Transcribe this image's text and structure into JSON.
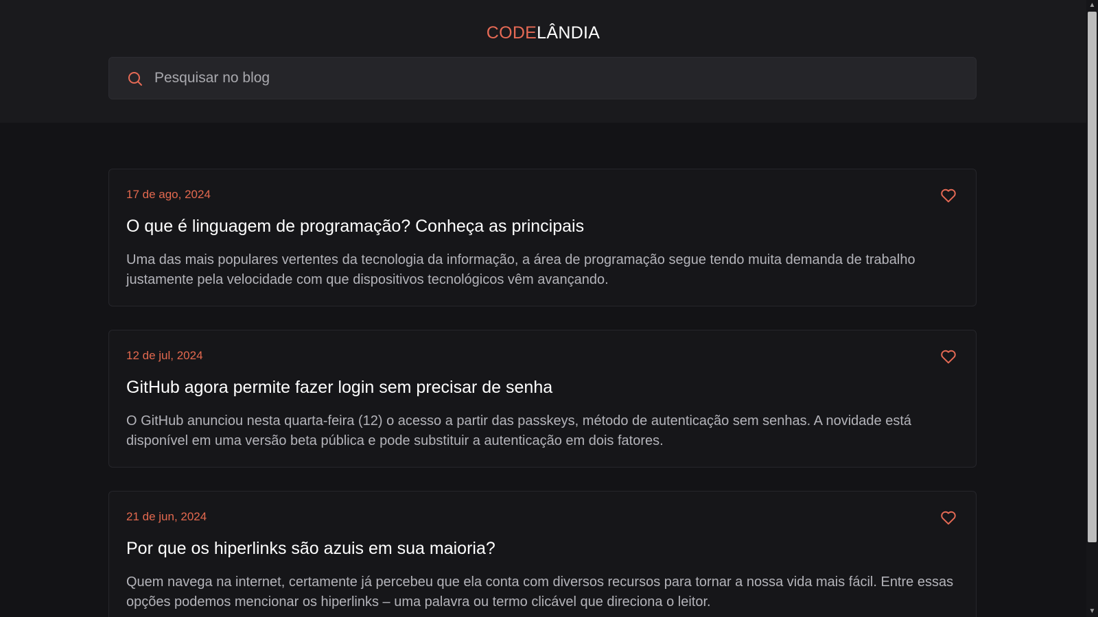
{
  "header": {
    "logo_accent": "CODE",
    "logo_rest": "LÂNDIA"
  },
  "search": {
    "placeholder": "Pesquisar no blog",
    "value": "",
    "icon": "search-icon"
  },
  "posts": [
    {
      "date": "17 de ago, 2024",
      "title": "O que é linguagem de programação? Conheça as principais",
      "excerpt": "Uma das mais populares vertentes da tecnologia da informação, a área de programação segue tendo muita demanda de trabalho justamente pela velocidade com que dispositivos tecnológicos vêm avançando.",
      "icon": "heart-icon"
    },
    {
      "date": "12 de jul, 2024",
      "title": "GitHub agora permite fazer login sem precisar de senha",
      "excerpt": "O GitHub anunciou nesta quarta-feira (12) o acesso a partir das passkeys, método de autenticação sem senhas. A novidade está disponível em uma versão beta pública e pode substituir a autenticação em dois fatores.",
      "icon": "heart-icon"
    },
    {
      "date": "21 de jun, 2024",
      "title": "Por que os hiperlinks são azuis em sua maioria?",
      "excerpt": "Quem navega na internet, certamente já percebeu que ela conta com diversos recursos para tornar a nossa vida mais fácil. Entre essas opções podemos mencionar os hiperlinks – uma palavra ou termo clicável que direciona o leitor.",
      "icon": "heart-icon"
    }
  ],
  "colors": {
    "accent": "#e66a55",
    "background": "#131316",
    "header_background": "#1a1a1d",
    "card_background": "#161619"
  }
}
